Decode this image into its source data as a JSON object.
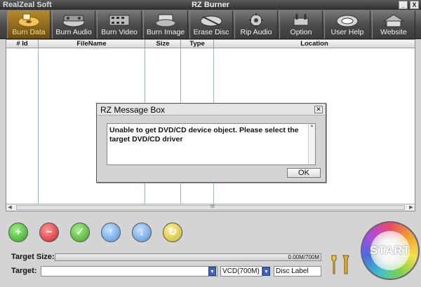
{
  "window": {
    "brand": "RealZeal Soft",
    "title": "RZ Burner",
    "minimize": "_",
    "close": "X"
  },
  "toolbar": {
    "items": [
      {
        "label": "Burn Data",
        "icon": "disc-data-icon",
        "active": true
      },
      {
        "label": "Burn Audio",
        "icon": "audio-icon"
      },
      {
        "label": "Burn Video",
        "icon": "film-icon"
      },
      {
        "label": "Burn Image",
        "icon": "disc-image-icon"
      },
      {
        "label": "Erase Disc",
        "icon": "erase-disc-icon"
      },
      {
        "label": "Rip Audio",
        "icon": "rip-gear-icon"
      },
      {
        "label": "Option",
        "icon": "option-tools-icon"
      },
      {
        "label": "User Help",
        "icon": "help-icon"
      },
      {
        "label": "Website",
        "icon": "website-icon"
      }
    ]
  },
  "filelist": {
    "columns": [
      "# Id",
      "FileName",
      "Size",
      "Type",
      "Location"
    ],
    "scroll_grip": "III"
  },
  "dialog": {
    "title": "RZ Message Box",
    "close": "✕",
    "message": "Unable to get DVD/CD device object. Please select the target DVD/CD driver",
    "ok": "OK"
  },
  "actions": {
    "add": "+",
    "remove": "−",
    "check": "✓",
    "up": "↑",
    "down": "↓",
    "refresh": "↻"
  },
  "bottom": {
    "target_size_label": "Target Size:",
    "size_value": "0.00M/700M",
    "target_label": "Target:",
    "target_value": "",
    "format_value": "VCD(700M)",
    "disc_label": "Disc Label",
    "start": "START"
  },
  "colors": {
    "accent": "#b98a2c",
    "toolbar": "#4a4a4a",
    "dropdown": "#3a64c8"
  }
}
